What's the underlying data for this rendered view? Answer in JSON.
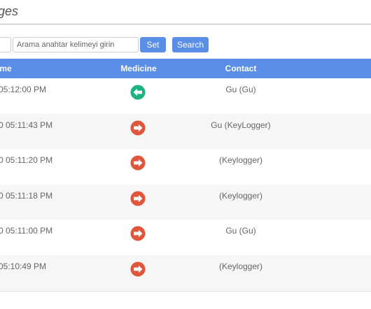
{
  "page": {
    "title": "ges"
  },
  "toolbar": {
    "search_placeholder": "Arama anahtar kelimeyi girin",
    "set_label": "Set",
    "search_label": "Search"
  },
  "table": {
    "headers": {
      "time": "ime",
      "medicine": "Medicine",
      "contact": "Contact"
    },
    "rows": [
      {
        "time": "05:12:00 PM",
        "direction": "incoming",
        "contact": "Gu (Gu)"
      },
      {
        "time": "0 05:11:43 PM",
        "direction": "outgoing",
        "contact": "Gu (KeyLogger)"
      },
      {
        "time": "0 05:11:20 PM",
        "direction": "outgoing",
        "contact": "(Keylogger)"
      },
      {
        "time": "0 05:11:18 PM",
        "direction": "outgoing",
        "contact": "(Keylogger)"
      },
      {
        "time": "0 05:11:00 PM",
        "direction": "outgoing",
        "contact": "Gu (Gu)"
      },
      {
        "time": "05:10:49 PM",
        "direction": "outgoing",
        "contact": "(Keylogger)"
      }
    ]
  },
  "colors": {
    "accent": "#5b8ee6",
    "incoming_icon": "#1db37e",
    "outgoing_icon": "#e1553a"
  },
  "icons": {
    "incoming": "arrow-left-circle-icon",
    "outgoing": "arrow-right-circle-icon"
  }
}
